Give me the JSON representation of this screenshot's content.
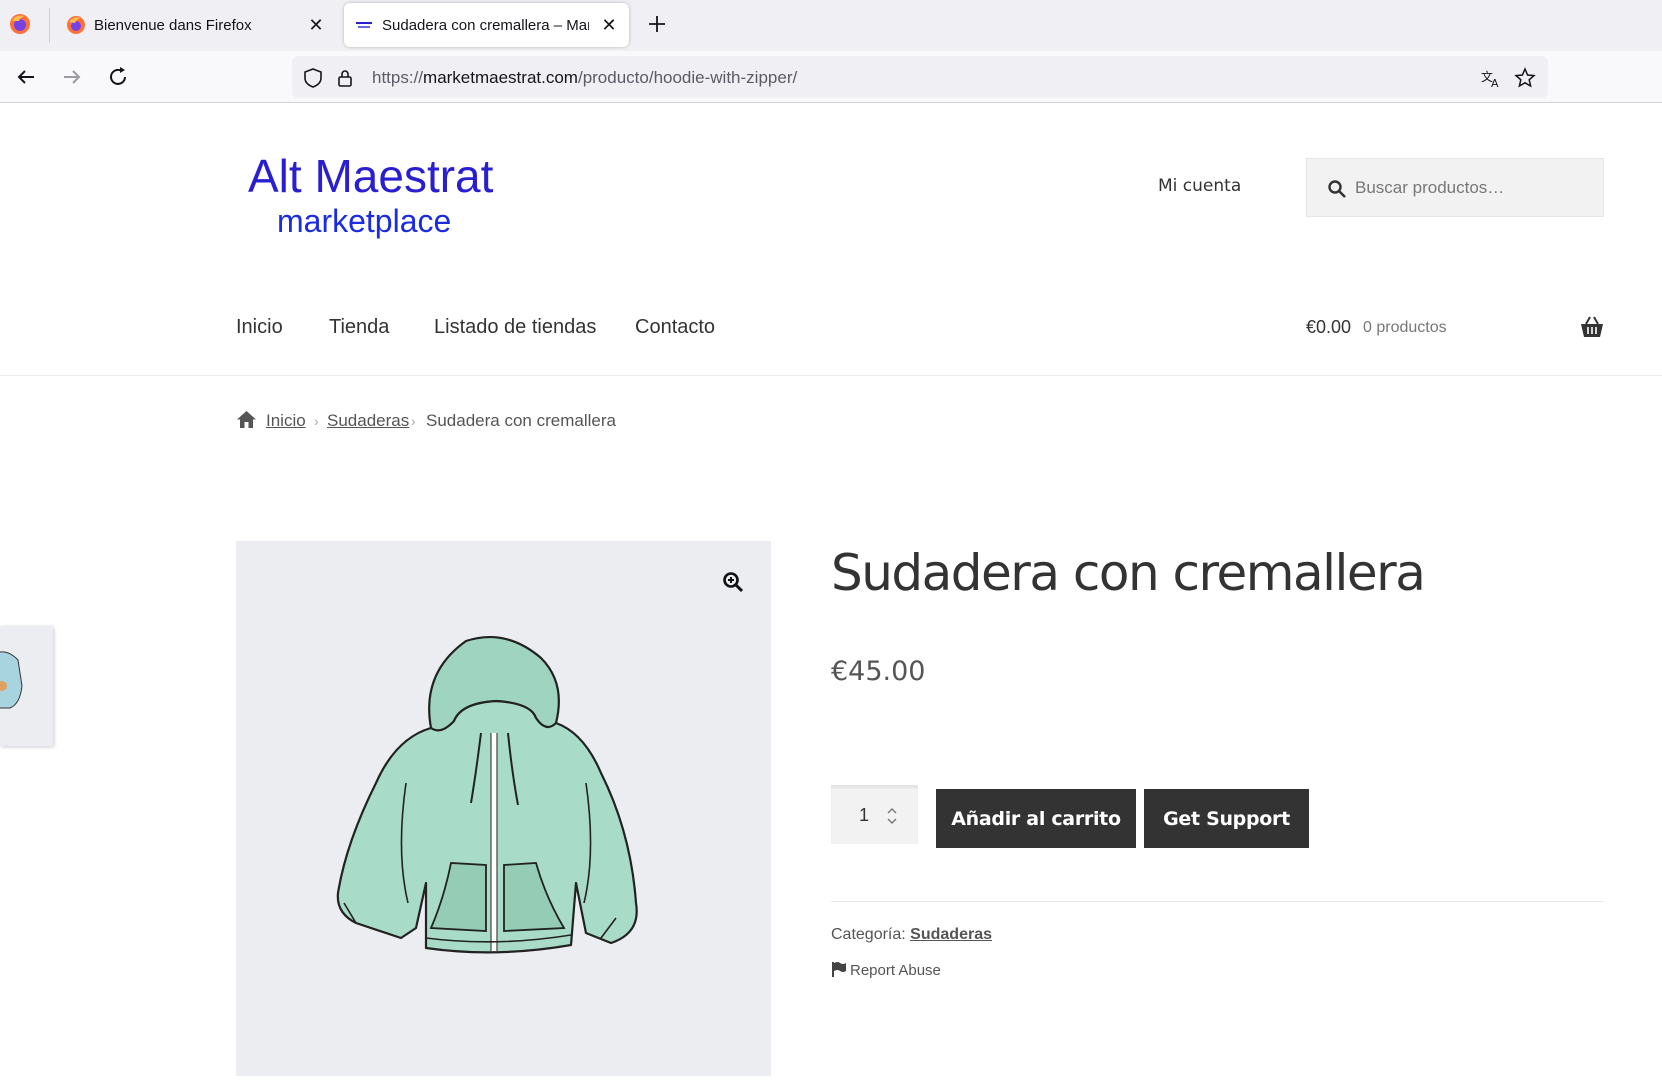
{
  "browser": {
    "tabs": [
      {
        "title": "Bienvenue dans Firefox",
        "active": false
      },
      {
        "title": "Sudadera con cremallera – Marketmaestrat",
        "active": true
      }
    ],
    "url": {
      "scheme": "https://",
      "host": "marketmaestrat.com",
      "path": "/producto/hoodie-with-zipper/"
    }
  },
  "site": {
    "logo_line1": "Alt Maestrat",
    "logo_line2": "marketplace",
    "account_link": "Mi cuenta",
    "search_placeholder": "Buscar productos…",
    "nav": [
      "Inicio",
      "Tienda",
      "Listado de tiendas",
      "Contacto"
    ],
    "cart_total": "€0.00",
    "cart_count": "0 productos"
  },
  "breadcrumb": {
    "items": [
      "Inicio",
      "Sudaderas",
      "Sudadera con cremallera"
    ]
  },
  "product": {
    "title": "Sudadera con cremallera",
    "price": "€45.00",
    "quantity": "1",
    "add_to_cart_label": "Añadir al carrito",
    "support_label": "Get Support",
    "category_label": "Categoría:",
    "category_value": "Sudaderas",
    "report_label": "Report Abuse"
  },
  "colors": {
    "logo": "#2a1fd0",
    "button_bg": "#333333",
    "hoodie": "#a8dcc8"
  }
}
